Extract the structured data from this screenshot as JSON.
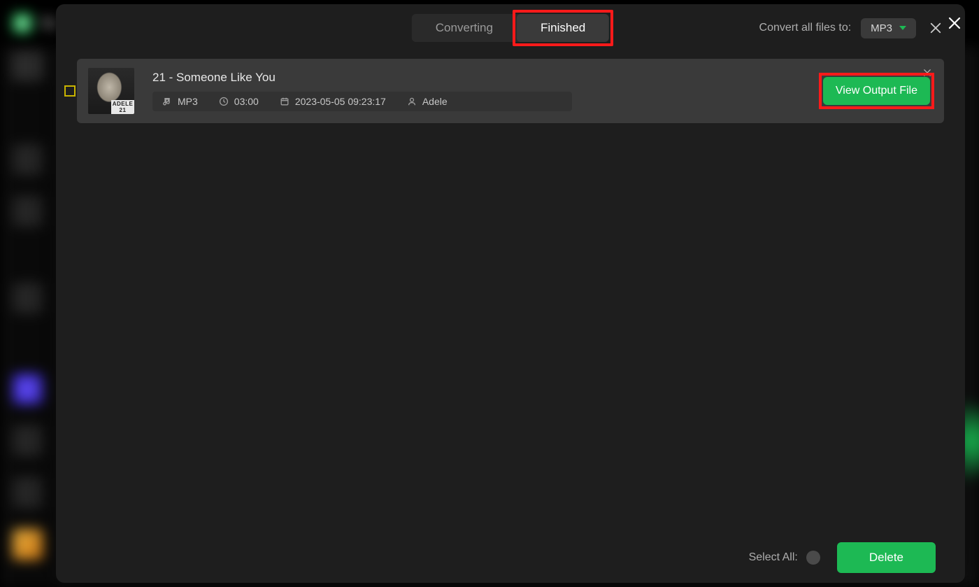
{
  "bg_app": {
    "name_initial": "Sp"
  },
  "header": {
    "tabs": {
      "converting": "Converting",
      "finished": "Finished"
    },
    "convert_label": "Convert all files to:",
    "format_value": "MP3"
  },
  "track": {
    "title": "21 - Someone Like You",
    "album_tag": "ADELE 21",
    "format": "MP3",
    "duration": "03:00",
    "timestamp": "2023-05-05 09:23:17",
    "artist": "Adele",
    "view_button": "View Output File"
  },
  "footer": {
    "select_all": "Select All:",
    "delete": "Delete"
  }
}
